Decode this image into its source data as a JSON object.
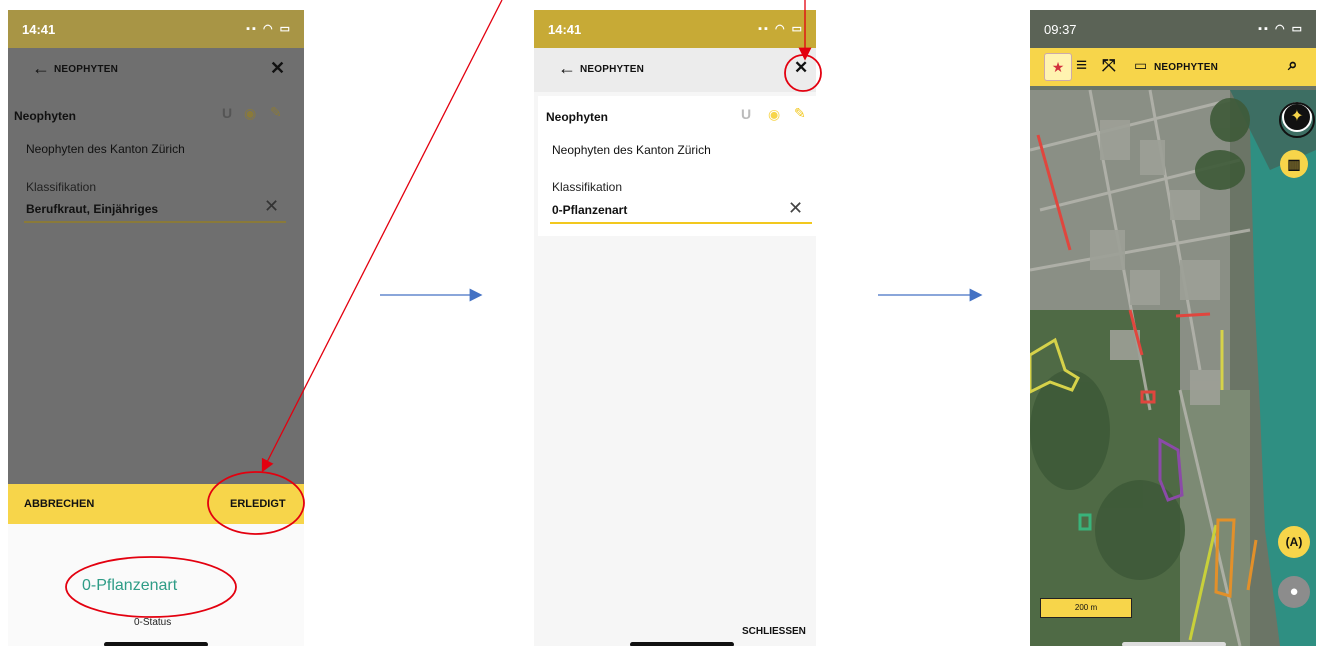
{
  "screens": [
    {
      "status_time": "14:41",
      "header_title": "NEOPHYTEN",
      "section_title": "Neophyten",
      "layer_name": "Neophyten des Kanton Zürich",
      "field_label": "Klassifikation",
      "field_value": "Berufkraut, Einjähriges",
      "picker_cancel": "ABBRECHEN",
      "picker_done": "ERLEDIGT",
      "picker_item": "0-Pflanzenart",
      "picker_sub": "0-Status"
    },
    {
      "status_time": "14:41",
      "header_title": "NEOPHYTEN",
      "section_title": "Neophyten",
      "layer_name": "Neophyten des Kanton Zürich",
      "field_label": "Klassifikation",
      "field_value": "0-Pflanzenart",
      "close_label": "SCHLIESSEN"
    },
    {
      "status_time": "09:37",
      "header_title": "NEOPHYTEN",
      "scale_label": "200 m",
      "antenna_label": "(A)"
    }
  ],
  "colors": {
    "yellow": "#F7D54A",
    "yellow_dark": "#C9A52A",
    "teal": "#2E9C86",
    "annotation_red": "#E3000F",
    "arrow_blue": "#4472C4",
    "overlay": "#6E6E6E"
  },
  "icons": [
    "back-arrow-icon",
    "close-icon",
    "magnet-icon",
    "eye-icon",
    "pencil-icon",
    "clear-icon",
    "menu-icon",
    "expand-icon",
    "folder-icon",
    "search-icon",
    "compass-icon",
    "map-icon",
    "location-icon"
  ]
}
